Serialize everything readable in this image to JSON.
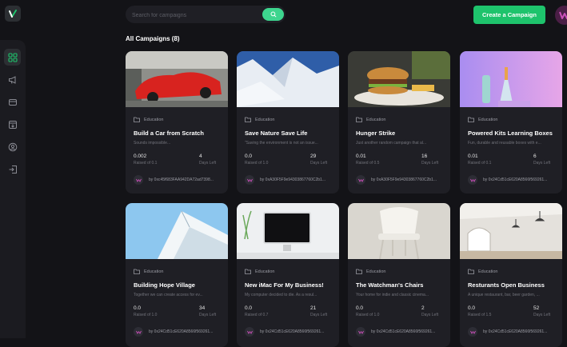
{
  "search": {
    "placeholder": "Search for campaigns"
  },
  "header": {
    "create_label": "Create a Campaign"
  },
  "heading": "All Campaigns (8)",
  "colors": {
    "accent": "#1ec36c",
    "search_button": "#3dd58e",
    "background": "#131317",
    "card": "#1f1f25"
  },
  "sidebar": {
    "items": [
      {
        "icon": "dashboard-icon",
        "active": true
      },
      {
        "icon": "megaphone-icon",
        "active": false
      },
      {
        "icon": "payment-icon",
        "active": false
      },
      {
        "icon": "withdraw-icon",
        "active": false
      },
      {
        "icon": "profile-icon",
        "active": false
      },
      {
        "icon": "logout-icon",
        "active": false
      }
    ]
  },
  "campaigns": [
    {
      "category": "Education",
      "title": "Build a Car from Scratch",
      "description": "Sounds impossible...",
      "collected": "0.002",
      "collected_label": "Raised of 0.1",
      "days": "4",
      "days_label": "Days Left",
      "owner": "by 0xc45f683FAA942DA72ad7398..."
    },
    {
      "category": "Education",
      "title": "Save Nature Save Life",
      "description": "\"Saving the environment is not an issue...",
      "collected": "0.0",
      "collected_label": "Raised of 1.0",
      "days": "29",
      "days_label": "Days Left",
      "owner": "by 0xA30F5F9e94303867760C2b1..."
    },
    {
      "category": "Education",
      "title": "Hunger Strike",
      "description": "Just another random campaign that al...",
      "collected": "0.01",
      "collected_label": "Raised of 0.5",
      "days": "16",
      "days_label": "Days Left",
      "owner": "by 0xA30F5F9e94303867760C2b1..."
    },
    {
      "category": "Education",
      "title": "Powered Kits Learning Boxes",
      "description": "Fun, durable and reusable boxes with e...",
      "collected": "0.01",
      "collected_label": "Raised of 0.1",
      "days": "6",
      "days_label": "Days Left",
      "owner": "by 0x24Cd51cE620A8566f569261..."
    },
    {
      "category": "Education",
      "title": "Building Hope Village",
      "description": "Together we can create access for ev...",
      "collected": "0.0",
      "collected_label": "Raised of 1.0",
      "days": "34",
      "days_label": "Days Left",
      "owner": "by 0x24Cd51cE620A8566f569261..."
    },
    {
      "category": "Education",
      "title": "New iMac For My Business!",
      "description": "My computer decided to die. As a resul...",
      "collected": "0.0",
      "collected_label": "Raised of 0.7",
      "days": "21",
      "days_label": "Days Left",
      "owner": "by 0x24Cd51cE620A8566f569261..."
    },
    {
      "category": "Education",
      "title": "The Watchman's Chairs",
      "description": "Your home for indie and classic cinema...",
      "collected": "0.0",
      "collected_label": "Raised of 1.0",
      "days": "2",
      "days_label": "Days Left",
      "owner": "by 0x24Cd51cE620A8566f569261..."
    },
    {
      "category": "Education",
      "title": "Resturants Open Business",
      "description": "A unique restaurant, bar, beer garden, ...",
      "collected": "0.0",
      "collected_label": "Raised of 1.5",
      "days": "52",
      "days_label": "Days Left",
      "owner": "by 0x24Cd51cE620A8566f569261..."
    }
  ]
}
